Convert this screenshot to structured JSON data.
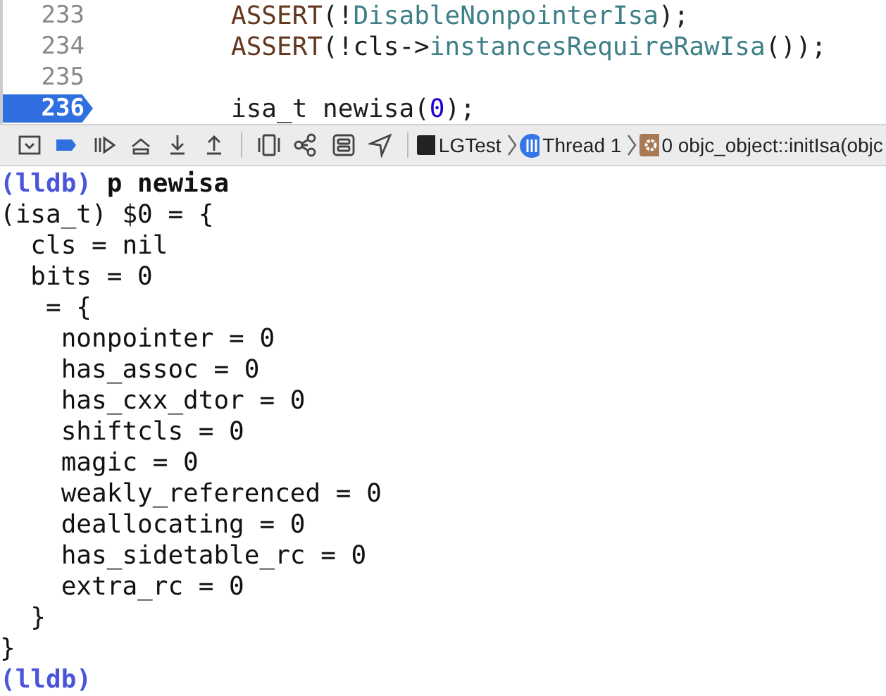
{
  "editor": {
    "lines": [
      {
        "number": "233",
        "current": false,
        "segments": [
          {
            "kind": "macro",
            "text": "ASSERT"
          },
          {
            "kind": "plain",
            "text": "(!"
          },
          {
            "kind": "method",
            "text": "DisableNonpointerIsa"
          },
          {
            "kind": "plain",
            "text": ");"
          }
        ]
      },
      {
        "number": "234",
        "current": false,
        "segments": [
          {
            "kind": "macro",
            "text": "ASSERT"
          },
          {
            "kind": "plain",
            "text": "(!cls->"
          },
          {
            "kind": "method",
            "text": "instancesRequireRawIsa"
          },
          {
            "kind": "plain",
            "text": "());"
          }
        ]
      },
      {
        "number": "235",
        "current": false
      },
      {
        "number": "236",
        "current": true,
        "segments": [
          {
            "kind": "type",
            "text": "isa_t"
          },
          {
            "kind": "plain",
            "text": " newisa("
          },
          {
            "kind": "number",
            "text": "0"
          },
          {
            "kind": "plain",
            "text": ");"
          }
        ]
      }
    ]
  },
  "debug_bar": {
    "breadcrumbs": [
      {
        "kind": "process",
        "label": "LGTest"
      },
      {
        "kind": "thread",
        "label": "Thread 1"
      },
      {
        "kind": "frame",
        "label": "0 objc_object::initIsa(objc"
      }
    ]
  },
  "console": {
    "lines": [
      {
        "prompt": "(lldb)",
        "text": "p newisa"
      },
      {
        "text": "(isa_t) $0 = {"
      },
      {
        "text": "  cls = nil"
      },
      {
        "text": "  bits = 0"
      },
      {
        "text": "   = {"
      },
      {
        "text": "    nonpointer = 0"
      },
      {
        "text": "    has_assoc = 0"
      },
      {
        "text": "    has_cxx_dtor = 0"
      },
      {
        "text": "    shiftcls = 0"
      },
      {
        "text": "    magic = 0"
      },
      {
        "text": "    weakly_referenced = 0"
      },
      {
        "text": "    deallocating = 0"
      },
      {
        "text": "    has_sidetable_rc = 0"
      },
      {
        "text": "    extra_rc = 0"
      },
      {
        "text": "  }"
      },
      {
        "text": "}"
      },
      {
        "prompt": "(lldb)"
      }
    ]
  }
}
